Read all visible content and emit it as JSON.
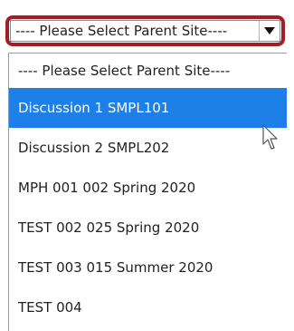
{
  "select": {
    "value": "---- Please Select Parent Site----",
    "arrow_icon": "caret-down-icon"
  },
  "dropdown": {
    "options": [
      {
        "label": "---- Please Select Parent Site----",
        "selected": false
      },
      {
        "label": "Discussion 1 SMPL101",
        "selected": true
      },
      {
        "label": "Discussion 2 SMPL202",
        "selected": false
      },
      {
        "label": "MPH 001 002 Spring 2020",
        "selected": false
      },
      {
        "label": "TEST 002 025 Spring 2020",
        "selected": false
      },
      {
        "label": "TEST 003 015 Summer 2020",
        "selected": false
      },
      {
        "label": "TEST 004",
        "selected": false
      }
    ]
  },
  "colors": {
    "highlight_border": "#a21e24",
    "selected_bg": "#1e7fe8",
    "selected_text": "#ffffff"
  },
  "cursor_icon": "mouse-pointer-icon"
}
